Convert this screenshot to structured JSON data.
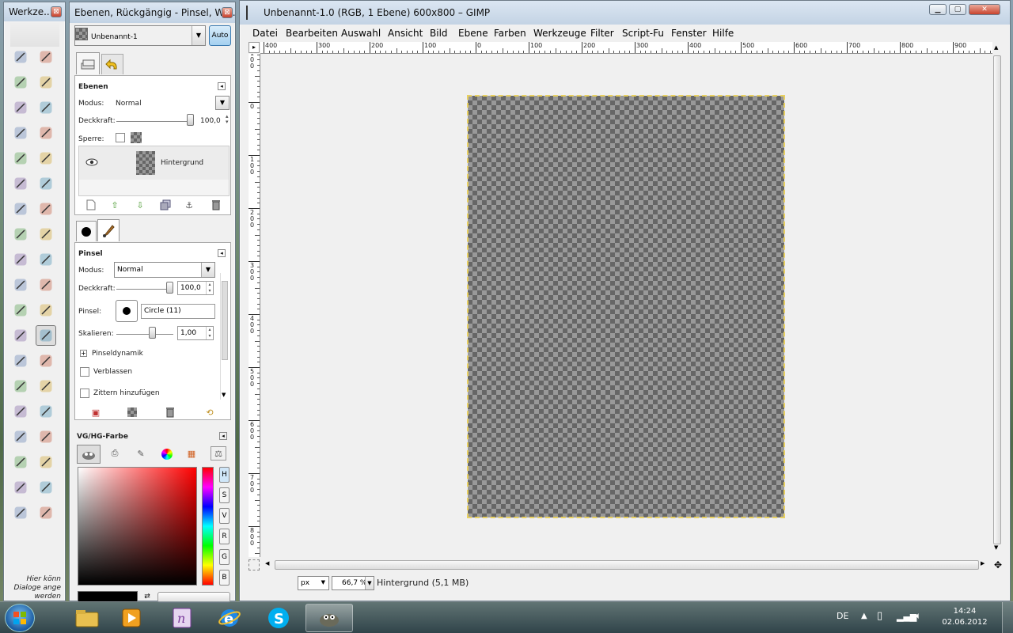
{
  "toolbox": {
    "title": "Werkze...",
    "hint_lines": [
      "Hier könn",
      "Dialoge ange",
      "werden"
    ],
    "tools": [
      "rect-select-icon",
      "ellipse-select-icon",
      "free-select-icon",
      "fuzzy-select-icon",
      "color-select-icon",
      "scissors-select-icon",
      "foreground-select-icon",
      "paths-icon",
      "color-picker-icon",
      "zoom-icon",
      "measure-icon",
      "move-icon",
      "align-icon",
      "crop-icon",
      "rotate-icon",
      "scale-icon",
      "shear-icon",
      "perspective-icon",
      "flip-icon",
      "text-icon",
      "bucket-fill-icon",
      "blend-icon",
      "pencil-icon",
      "paintbrush-icon",
      "eraser-icon",
      "airbrush-icon",
      "ink-icon",
      "clone-icon",
      "heal-icon",
      "perspective-clone-icon",
      "blur-icon",
      "smudge-icon",
      "dodge-burn-icon",
      "fg-bg-colors-icon",
      "color-levels-icon",
      "color-curves-icon",
      "color-balance-icon",
      "dodge-icon"
    ],
    "selected_tool_index": 23
  },
  "dock": {
    "title": "Ebenen, Rückgängig - Pinsel, We...",
    "image_select": "Unbenannt-1",
    "auto_label": "Auto",
    "layers": {
      "header": "Ebenen",
      "mode_label": "Modus:",
      "mode_value": "Normal",
      "opacity_label": "Deckkraft:",
      "opacity_value": "100,0",
      "lock_label": "Sperre:",
      "layer_name": "Hintergrund"
    },
    "brush": {
      "header": "Pinsel",
      "mode_label": "Modus:",
      "mode_value": "Normal",
      "opacity_label": "Deckkraft:",
      "opacity_value": "100,0",
      "brush_label": "Pinsel:",
      "brush_name": "Circle (11)",
      "scale_label": "Skalieren:",
      "scale_value": "1,00",
      "dynamics_label": "Pinseldynamik",
      "fade_label": "Verblassen",
      "jitter_label": "Zittern hinzufügen"
    },
    "colors": {
      "header": "VG/HG-Farbe",
      "channel_buttons": [
        "H",
        "S",
        "V",
        "R",
        "G",
        "B"
      ]
    }
  },
  "main": {
    "title": "Unbenannt-1.0 (RGB, 1 Ebene) 600x800 – GIMP",
    "menu": [
      "Datei",
      "Bearbeiten",
      "Auswahl",
      "Ansicht",
      "Bild",
      "Ebene",
      "Farben",
      "Werkzeuge",
      "Filter",
      "Script-Fu",
      "Fenster",
      "Hilfe"
    ],
    "hruler_labels": [
      "400",
      "300",
      "200",
      "100",
      "0",
      "100",
      "200",
      "300",
      "400",
      "500",
      "600",
      "700",
      "800",
      "900"
    ],
    "vruler_labels": [
      "100",
      "0",
      "100",
      "200",
      "300",
      "400",
      "500",
      "600",
      "700",
      "800"
    ],
    "units": "px",
    "zoom": "66,7 %",
    "status": "Hintergrund (5,1 MB)"
  },
  "taskbar": {
    "apps": [
      "file-explorer-icon",
      "media-player-icon",
      "onenote-icon",
      "internet-explorer-icon",
      "skype-icon",
      "gimp-icon"
    ],
    "language": "DE",
    "time": "14:24",
    "date": "02.06.2012"
  }
}
